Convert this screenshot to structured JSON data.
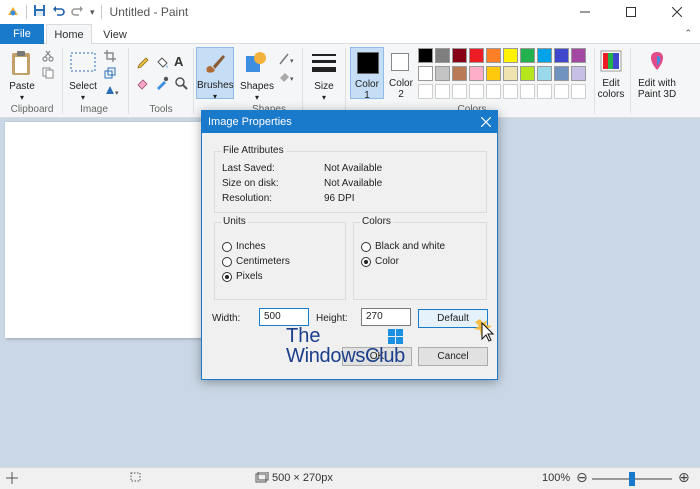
{
  "window": {
    "title": "Untitled - Paint"
  },
  "tabs": {
    "file": "File",
    "home": "Home",
    "view": "View"
  },
  "ribbon": {
    "clipboard": {
      "paste": "Paste",
      "label": "Clipboard"
    },
    "image": {
      "select": "Select",
      "label": "Image"
    },
    "tools": {
      "label": "Tools"
    },
    "brushes": "Brushes",
    "shapes": {
      "shapes": "Shapes",
      "label": "Shapes"
    },
    "size": "Size",
    "color1": [
      "Color",
      "1"
    ],
    "color2": [
      "Color",
      "2"
    ],
    "colors_label": "Colors",
    "edit_colors": [
      "Edit",
      "colors"
    ],
    "edit_3d": [
      "Edit with",
      "Paint 3D"
    ],
    "palette_row1": [
      "#000000",
      "#7f7f7f",
      "#880015",
      "#ed1c24",
      "#ff7f27",
      "#fff200",
      "#22b14c",
      "#00a2e8",
      "#3f48cc",
      "#a349a4"
    ],
    "palette_row2": [
      "#ffffff",
      "#c3c3c3",
      "#b97a57",
      "#ffaec9",
      "#ffc90e",
      "#efe4b0",
      "#b5e61d",
      "#99d9ea",
      "#7092be",
      "#c8bfe7"
    ]
  },
  "dialog": {
    "title": "Image Properties",
    "attributes": {
      "legend": "File Attributes",
      "rows": [
        {
          "label": "Last Saved:",
          "value": "Not Available"
        },
        {
          "label": "Size on disk:",
          "value": "Not Available"
        },
        {
          "label": "Resolution:",
          "value": "96 DPI"
        }
      ]
    },
    "units": {
      "legend": "Units",
      "options": [
        "Inches",
        "Centimeters",
        "Pixels"
      ],
      "selected": "Pixels"
    },
    "colors": {
      "legend": "Colors",
      "options": [
        "Black and white",
        "Color"
      ],
      "selected": "Color"
    },
    "width_label": "Width:",
    "width_value": "500",
    "height_label": "Height:",
    "height_value": "270",
    "default_button": "Default",
    "ok_button": "OK",
    "cancel_button": "Cancel"
  },
  "watermark": {
    "line1": "The",
    "line2": "WindowsClub"
  },
  "status": {
    "dimensions": "500 × 270px",
    "zoom": "100%",
    "zoom_level": 0.5
  }
}
